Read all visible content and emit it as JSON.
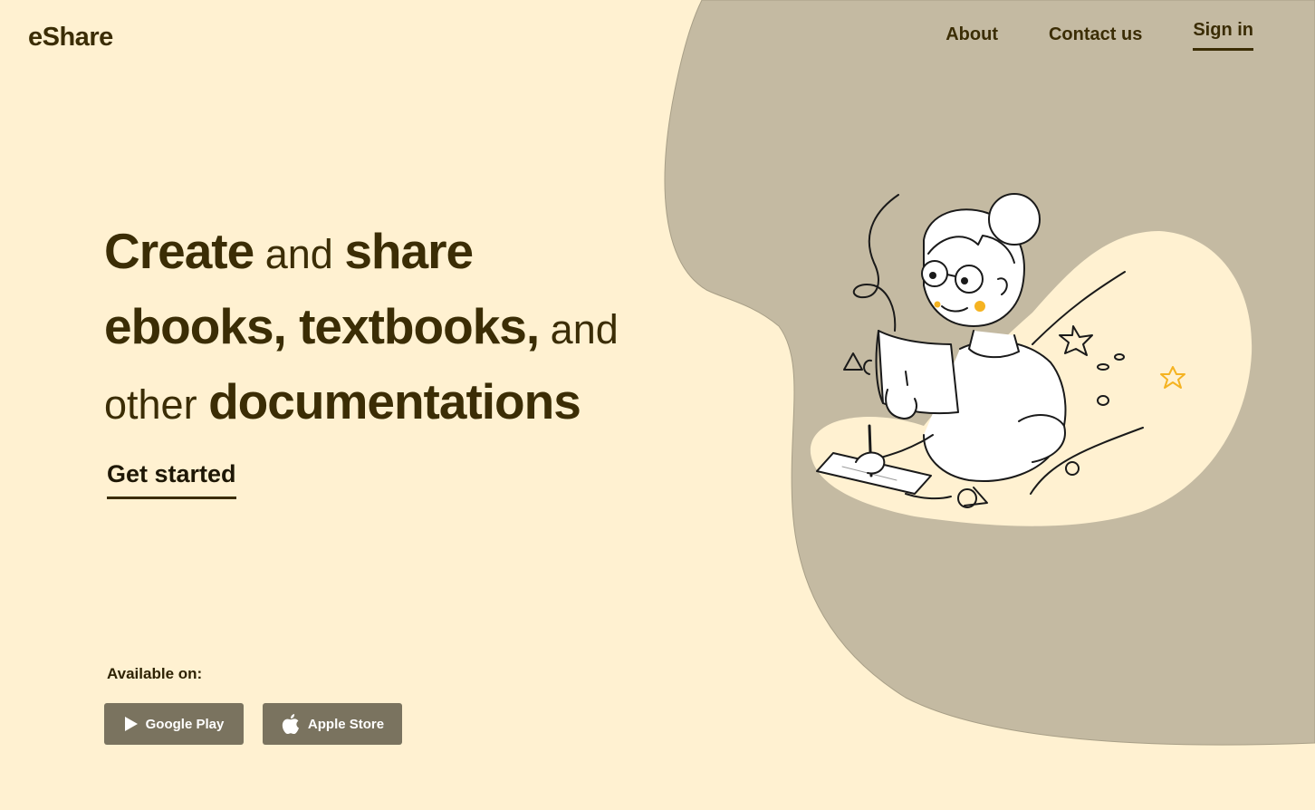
{
  "header": {
    "logo": "eShare",
    "nav": [
      {
        "label": "About"
      },
      {
        "label": "Contact us"
      },
      {
        "label": "Sign in"
      }
    ]
  },
  "hero": {
    "line1": [
      {
        "text": "Create",
        "style": "big"
      },
      {
        "text": " and ",
        "style": "small"
      },
      {
        "text": "share",
        "style": "big"
      }
    ],
    "line2": [
      {
        "text": "ebooks, textbooks,",
        "style": "big"
      },
      {
        "text": " and",
        "style": "small"
      }
    ],
    "line3": [
      {
        "text": "other ",
        "style": "small"
      },
      {
        "text": " documentations",
        "style": "big"
      }
    ],
    "cta_label": "Get started"
  },
  "stores": {
    "available_label": "Available on:",
    "google_play": {
      "label": "Google Play",
      "icon": "play-icon"
    },
    "apple_store": {
      "label": "Apple Store",
      "icon": "apple-icon"
    }
  },
  "colors": {
    "background": "#fff1d1",
    "blob": "#c4baa2",
    "text": "#3b2d05",
    "button": "#7a735f",
    "accent": "#f5b321"
  }
}
